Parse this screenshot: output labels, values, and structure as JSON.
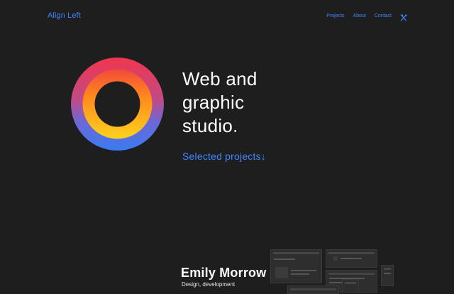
{
  "header": {
    "logo": "Align Left",
    "nav": [
      {
        "label": "Projects"
      },
      {
        "label": "About"
      },
      {
        "label": "Contact"
      }
    ],
    "theme_toggle_icon": "utensils-icon"
  },
  "hero": {
    "headline_lines": [
      "Web and",
      "graphic",
      "studio."
    ],
    "projects_link": "Selected projects↓"
  },
  "project": {
    "title": "Emily Morrow",
    "subtitle": "Design, development"
  },
  "colors": {
    "background": "#1e1e1e",
    "accent": "#3f86ff",
    "ring_red": "#f0364d",
    "ring_orange": "#ff8a1c",
    "ring_yellow": "#ffd21e",
    "ring_blue": "#3b7bf0"
  }
}
